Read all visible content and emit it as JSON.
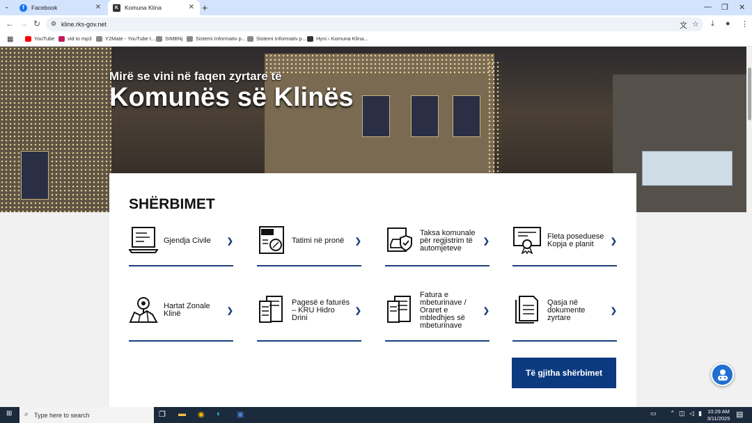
{
  "browser": {
    "tabs": [
      {
        "title": "Facebook"
      },
      {
        "title": "Komuna Klina"
      }
    ],
    "url": "kline.rks-gov.net",
    "bookmarks": [
      {
        "label": "YouTube"
      },
      {
        "label": "vid to mp3"
      },
      {
        "label": "Y2Mate - YouTube t..."
      },
      {
        "label": "SIMBNj"
      },
      {
        "label": "Sistemi Informativ p..."
      },
      {
        "label": "Sistemi Informativ p..."
      },
      {
        "label": "Hyni ‹ Komuna Klina..."
      }
    ]
  },
  "hero": {
    "welcome": "Mirë se vini në faqen zyrtare të",
    "title": "Komunës së Klinës"
  },
  "services": {
    "heading": "SHËRBIMET",
    "items": [
      {
        "label": "Gjendja Civile",
        "icon": "laptop-icon"
      },
      {
        "label": "Tatimi në pronë",
        "icon": "tax-document-icon"
      },
      {
        "label": "Taksa komunale për regjistrim të automjeteve",
        "icon": "car-shield-icon"
      },
      {
        "label": "Fleta poseduese Kopja e planit",
        "icon": "certificate-icon"
      },
      {
        "label": "Hartat Zonale Klinë",
        "icon": "map-pin-icon"
      },
      {
        "label": "Pagesë e faturës – KRU Hidro Drini",
        "icon": "receipt-icon"
      },
      {
        "label": "Fatura e mbeturinave / Oraret e mbledhjes së mbeturinave",
        "icon": "invoice-list-icon"
      },
      {
        "label": "Qasja në dokumente zyrtare",
        "icon": "documents-icon"
      }
    ],
    "all_button": "Të gjitha shërbimet"
  },
  "taskbar": {
    "search_placeholder": "Type here to search",
    "time": "10:29 AM",
    "date": "3/11/2025"
  },
  "colors": {
    "accent": "#0c3a80",
    "tabbar": "#d3e3fd",
    "taskbar": "#1b2a3d"
  }
}
